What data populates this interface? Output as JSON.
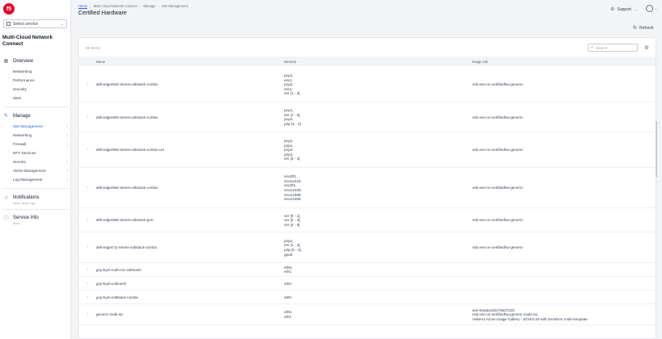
{
  "logo_text": "f5",
  "service_select": {
    "label": "Select service"
  },
  "app_title": "Multi-Cloud Network Connect",
  "nav": {
    "overview": {
      "label": "Overview",
      "items": [
        "Networking",
        "Performance",
        "Security",
        "Sites"
      ]
    },
    "manage": {
      "label": "Manage",
      "items": [
        {
          "label": "Site Management",
          "arrow": "›",
          "active": true
        },
        {
          "label": "Networking",
          "arrow": "›"
        },
        {
          "label": "Firewall",
          "arrow": "›"
        },
        {
          "label": "NFV Services",
          "arrow": ""
        },
        {
          "label": "Secrets",
          "arrow": "›"
        },
        {
          "label": "Alerts Management",
          "arrow": "›"
        },
        {
          "label": "Log Management",
          "arrow": "›"
        }
      ]
    },
    "notifications": {
      "label": "Notifications",
      "note": "Alerts, Audit Logs"
    },
    "service_info": {
      "label": "Service Info",
      "note": "About"
    }
  },
  "breadcrumb": [
    "Home",
    "Multi-Cloud Network Connect",
    "Manage",
    "Site Management"
  ],
  "page_title": "Certified Hardware",
  "header": {
    "support": "Support"
  },
  "refresh_label": "Refresh",
  "item_count": "68 items",
  "search": {
    "placeholder": "Search"
  },
  "table": {
    "columns": [
      "Name",
      "Devices",
      "Image List"
    ],
    "rows": [
      {
        "name": "dell-edger640-series-voltstack-combo",
        "devices": [
          "p1p1,",
          "em3,",
          "p1p2,",
          "em4,",
          "em [1 - 2]"
        ],
        "images": [
          "vsb-ves-ce-certifiedhw-generic-"
        ]
      },
      {
        "name": "dell-edger650-series-voltstack-combo",
        "devices": [
          "p1p1,",
          "em [1 - 6],",
          "p1p2,",
          "p2p [1 - 2]"
        ],
        "images": [
          "vsb-ves-ce-certifiedhw-generic-"
        ]
      },
      {
        "name": "dell-edger650-series-voltstack-combo-ucl",
        "devices": [
          "p1p1,",
          "p2p1,",
          "p1p2,",
          "p2p2,",
          "em [3 - 4]"
        ],
        "images": [
          "vsb-ves-ce-certifiedhw-generic-"
        ]
      },
      {
        "name": "dell-edger660-series-voltstack-combo",
        "devices": [
          "eno2f0,",
          "eno12419,",
          "eno2f1,",
          "eno12429,",
          "eno12399,",
          "eno12409"
        ],
        "images": [
          "vsb-ves-ce-certifiedhw-generic-"
        ]
      },
      {
        "name": "dell-edger660-series-voltstack-gnic",
        "devices": [
          "ver [0 - 1],",
          "ver [2 - 3],",
          "ver [4 - 5]"
        ],
        "images": [
          "vsb-ves-ce-certifiedhw-generic-"
        ]
      },
      {
        "name": "dell-edgerr11-series-voltstack-combo",
        "devices": [
          "p2p1,",
          "em [1 - 4],",
          "p2p [2 - 4],",
          "gpu0"
        ],
        "images": [
          "vsb-ves-ce-certifiedhw-generic-"
        ]
      },
      {
        "name": "gcp-byol-multi-nic-voltmesh",
        "devices": [
          "eth0,",
          "eth1"
        ],
        "images": []
      },
      {
        "name": "gcp-byol-voltmesh",
        "devices": [
          "eth0"
        ],
        "images": []
      },
      {
        "name": "gcp-byol-voltstack-combo",
        "devices": [
          "eth0"
        ],
        "images": []
      },
      {
        "name": "generic-multi-nic",
        "devices": [
          "eth0,",
          "eth1"
        ],
        "images": [
          "ami-0eadac5d175627120,",
          "vsb-ves-ce-certifiedhw-generic-multi-nic,",
          "Volterra Azure Image Gallery - 2019.8.30 with terraform multi-template"
        ]
      }
    ]
  }
}
